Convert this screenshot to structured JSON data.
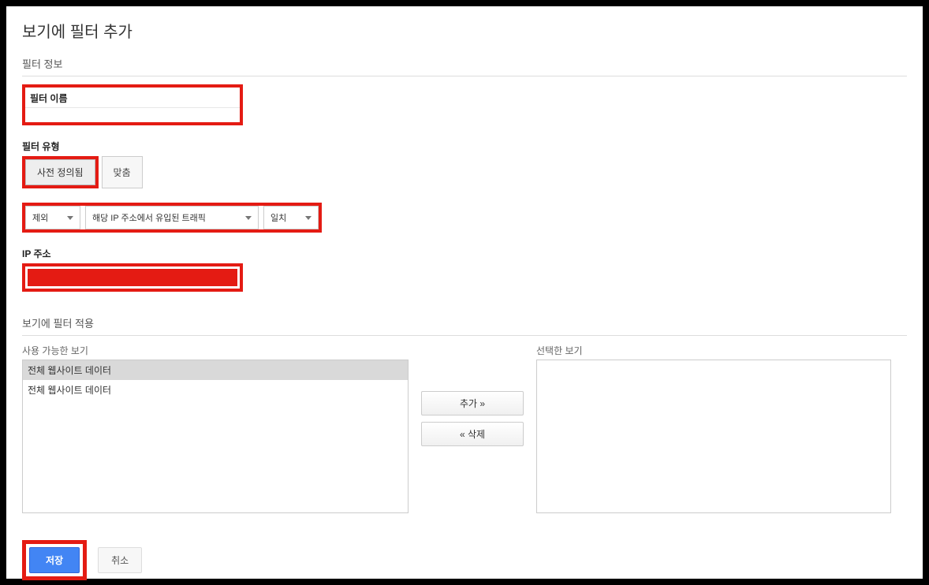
{
  "page": {
    "title": "보기에 필터 추가"
  },
  "filter_info": {
    "section_title": "필터 정보",
    "name_label": "필터 이름",
    "name_value": ""
  },
  "filter_type": {
    "section_title": "필터 유형",
    "predefined_label": "사전 정의됨",
    "custom_label": "맞춤",
    "dropdowns": {
      "exclude": "제외",
      "traffic_source": "해당 IP 주소에서 유입된 트래픽",
      "match": "일치"
    }
  },
  "ip": {
    "label": "IP 주소"
  },
  "apply": {
    "section_title": "보기에 필터 적용",
    "available_label": "사용 가능한 보기",
    "selected_label": "선택한 보기",
    "available_items": [
      "전체 웹사이트 데이터",
      "전체 웹사이트 데이터"
    ],
    "add_btn": "추가 »",
    "remove_btn": "« 삭제"
  },
  "footer": {
    "save": "저장",
    "cancel": "취소"
  },
  "colors": {
    "highlight": "#e41b13",
    "primary": "#4285f4"
  }
}
